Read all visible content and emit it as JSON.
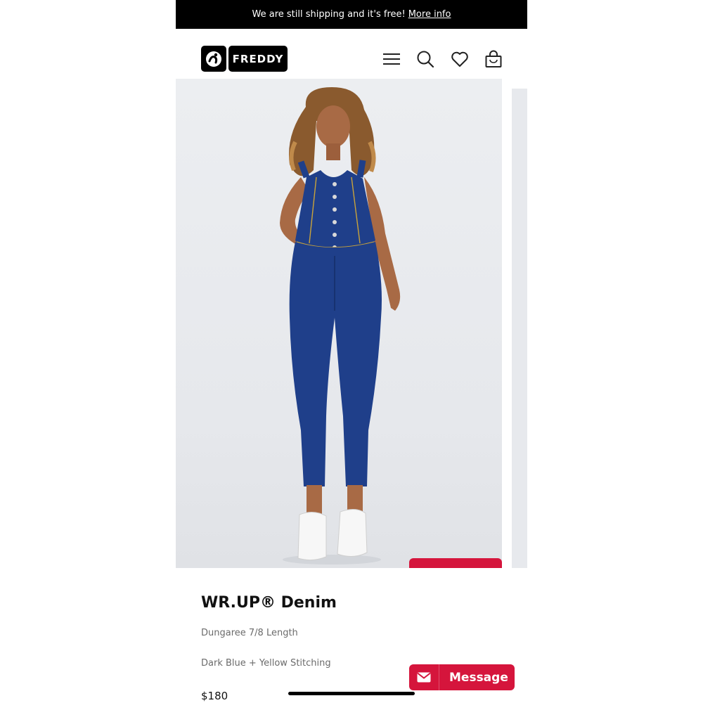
{
  "announcement": {
    "text": "We are still shipping and it's free!",
    "link": "More info"
  },
  "header": {
    "logo_text": "FREDDY",
    "icons": [
      "menu-icon",
      "search-icon",
      "heart-icon",
      "shopping-bag-icon"
    ]
  },
  "product": {
    "title": "WR.UP® Denim",
    "subtitle": "Dungaree 7/8 Length",
    "color": "Dark Blue + Yellow Stitching",
    "price": "$180"
  },
  "chat": {
    "label": "Message"
  },
  "colors": {
    "accent": "#d5153c",
    "bar": "#000000",
    "denim": "#1f3f8a"
  }
}
